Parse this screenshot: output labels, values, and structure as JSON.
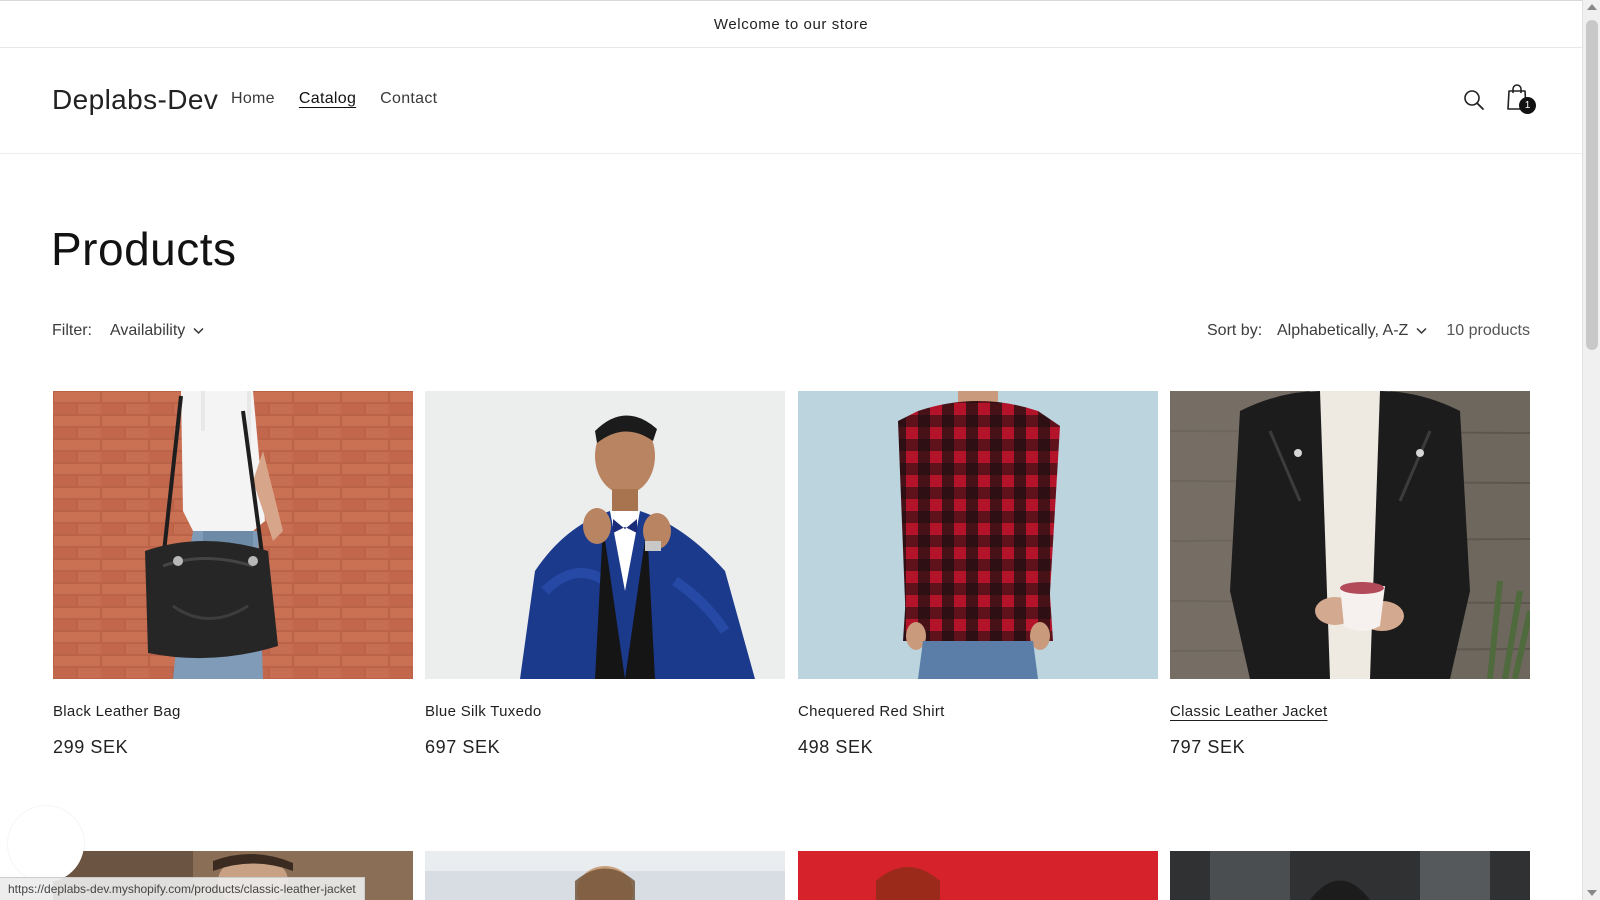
{
  "announcement": {
    "text": "Welcome to our store"
  },
  "header": {
    "logo": "Deplabs-Dev",
    "nav": [
      {
        "label": "Home",
        "active": false
      },
      {
        "label": "Catalog",
        "active": true
      },
      {
        "label": "Contact",
        "active": false
      }
    ],
    "search_icon": "search-icon",
    "cart_icon": "cart-bag-icon",
    "cart_count": "1"
  },
  "collection": {
    "title": "Products",
    "filter_label": "Filter:",
    "filter_value": "Availability",
    "sort_label": "Sort by:",
    "sort_value": "Alphabetically, A-Z",
    "product_count": "10 products"
  },
  "products": [
    {
      "title": "Black Leather Bag",
      "price": "299 SEK",
      "hovered": false
    },
    {
      "title": "Blue Silk Tuxedo",
      "price": "697 SEK",
      "hovered": false
    },
    {
      "title": "Chequered Red Shirt",
      "price": "498 SEK",
      "hovered": false
    },
    {
      "title": "Classic Leather Jacket",
      "price": "797 SEK",
      "hovered": true
    }
  ],
  "status_bar": {
    "url": "https://deplabs-dev.myshopify.com/products/classic-leather-jacket"
  },
  "colors": {
    "text": "#121212",
    "border": "#e8e8e8",
    "background": "#ffffff"
  }
}
